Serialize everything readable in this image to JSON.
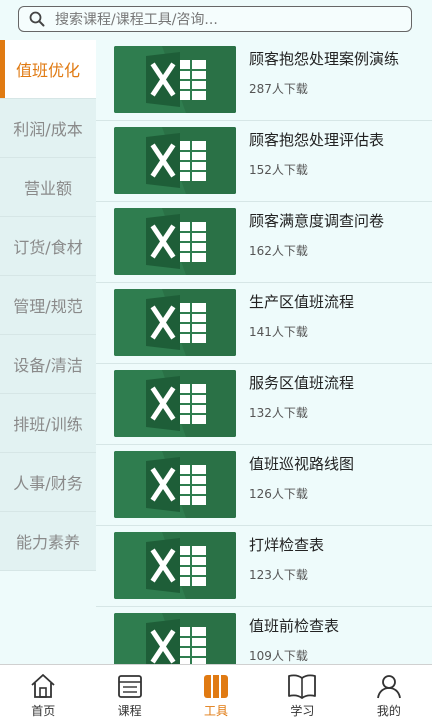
{
  "search": {
    "placeholder": "搜索课程/课程工具/咨询..."
  },
  "sidebar": {
    "items": [
      {
        "label": "值班优化",
        "active": true
      },
      {
        "label": "利润/成本"
      },
      {
        "label": "营业额"
      },
      {
        "label": "订货/食材"
      },
      {
        "label": "管理/规范"
      },
      {
        "label": "设备/清洁"
      },
      {
        "label": "排班/训练"
      },
      {
        "label": "人事/财务"
      },
      {
        "label": "能力素养"
      }
    ]
  },
  "list": {
    "items": [
      {
        "title": "顾客抱怨处理案例演练",
        "downloads": "287人下载",
        "icon": "excel-file-icon"
      },
      {
        "title": "顾客抱怨处理评估表",
        "downloads": "152人下载",
        "icon": "excel-file-icon"
      },
      {
        "title": "顾客满意度调查问卷",
        "downloads": "162人下载",
        "icon": "excel-file-icon"
      },
      {
        "title": "生产区值班流程",
        "downloads": "141人下载",
        "icon": "excel-file-icon"
      },
      {
        "title": "服务区值班流程",
        "downloads": "132人下载",
        "icon": "excel-file-icon"
      },
      {
        "title": "值班巡视路线图",
        "downloads": "126人下载",
        "icon": "excel-file-icon"
      },
      {
        "title": "打烊检查表",
        "downloads": "123人下载",
        "icon": "excel-file-icon"
      },
      {
        "title": "值班前检查表",
        "downloads": "109人下载",
        "icon": "excel-file-icon"
      }
    ]
  },
  "nav": {
    "items": [
      {
        "label": "首页",
        "icon": "home-icon"
      },
      {
        "label": "课程",
        "icon": "course-icon"
      },
      {
        "label": "工具",
        "icon": "tools-icon",
        "active": true
      },
      {
        "label": "学习",
        "icon": "book-icon"
      },
      {
        "label": "我的",
        "icon": "user-icon"
      }
    ]
  },
  "colors": {
    "accent": "#e07a12",
    "excel_green": "#2f7d4f",
    "background": "#eefbfb"
  }
}
